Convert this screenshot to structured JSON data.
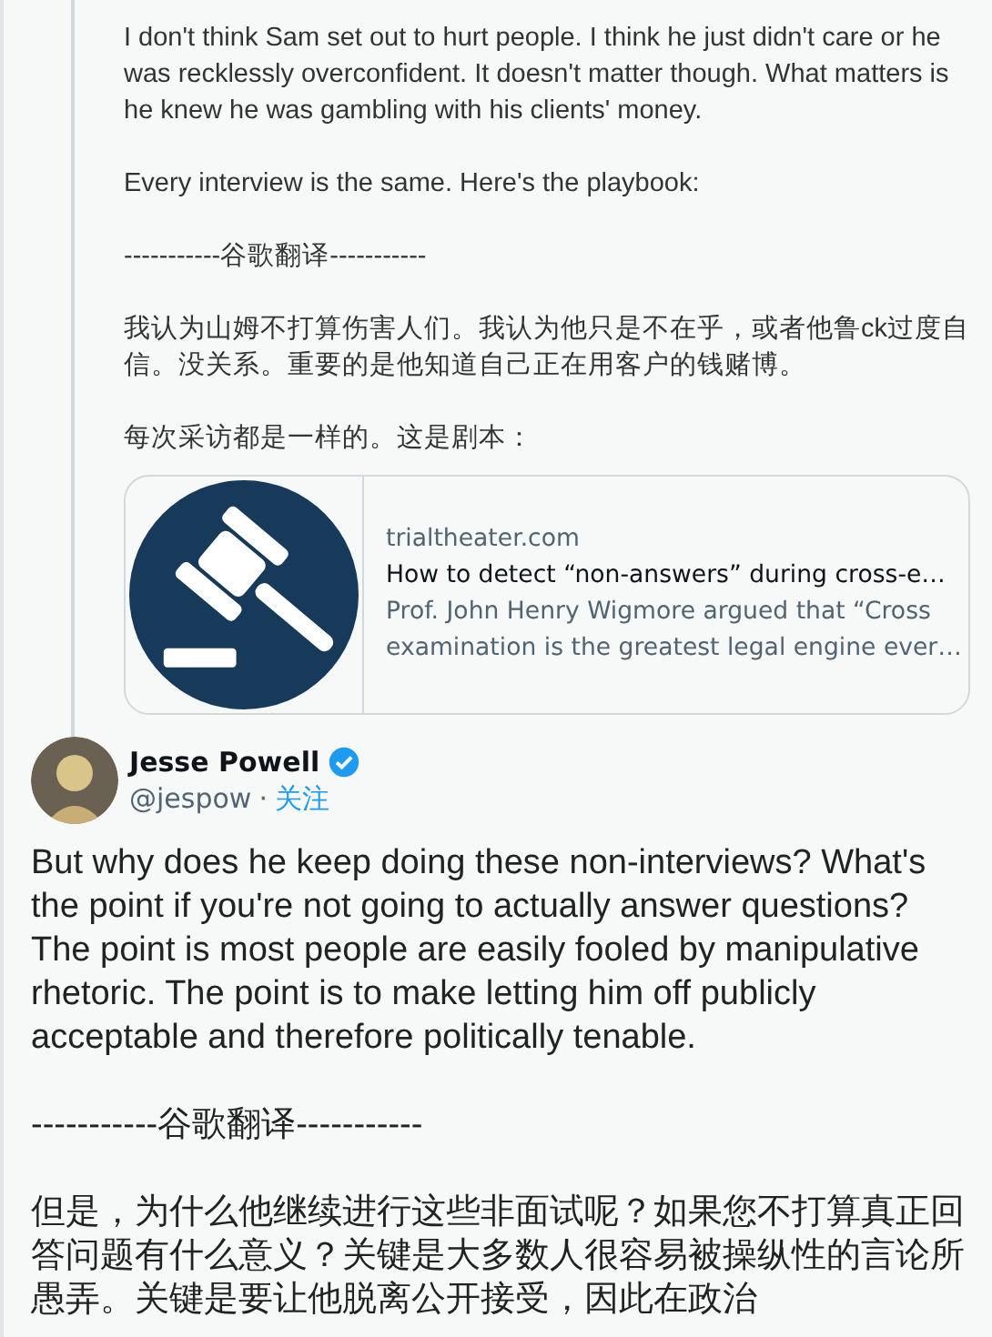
{
  "reply_tweet": {
    "paragraphs": [
      "I don't think Sam set out to hurt people. I think he just didn't care or he was recklessly overconfident. It doesn't matter though. What matters is he knew he was gambling with his clients' money.",
      "Every interview is the same. Here's the playbook:",
      "-----------谷歌翻译-----------",
      "我认为山姆不打算伤害人们。我认为他只是不在乎，或者他鲁ck过度自信。没关系。重要的是他知道自己正在用客户的钱赌博。",
      "每次采访都是一样的。这是剧本："
    ],
    "link_card": {
      "domain": "trialtheater.com",
      "title": "How to detect “non-answers” during cross-e…",
      "description": "Prof. John Henry Wigmore argued that “Cross examination is the greatest legal engine ever…"
    }
  },
  "tweet": {
    "author": {
      "name": "Jesse Powell",
      "verified": true,
      "handle": "@jespow",
      "separator": "·",
      "follow": "关注"
    },
    "paragraphs": [
      "But why does he keep doing these non-interviews? What's the point if you're not going to actually answer questions? The point is most people are easily fooled by manipulative rhetoric. The point is to make letting him off publicly acceptable and therefore politically tenable.",
      "-----------谷歌翻译-----------",
      "但是，为什么他继续进行这些非面试呢？如果您不打算真正回答问题有什么意义？关键是大多数人很容易被操纵性的言论所愚弄。关键是要让他脱离公开接受，因此在政治"
    ]
  }
}
